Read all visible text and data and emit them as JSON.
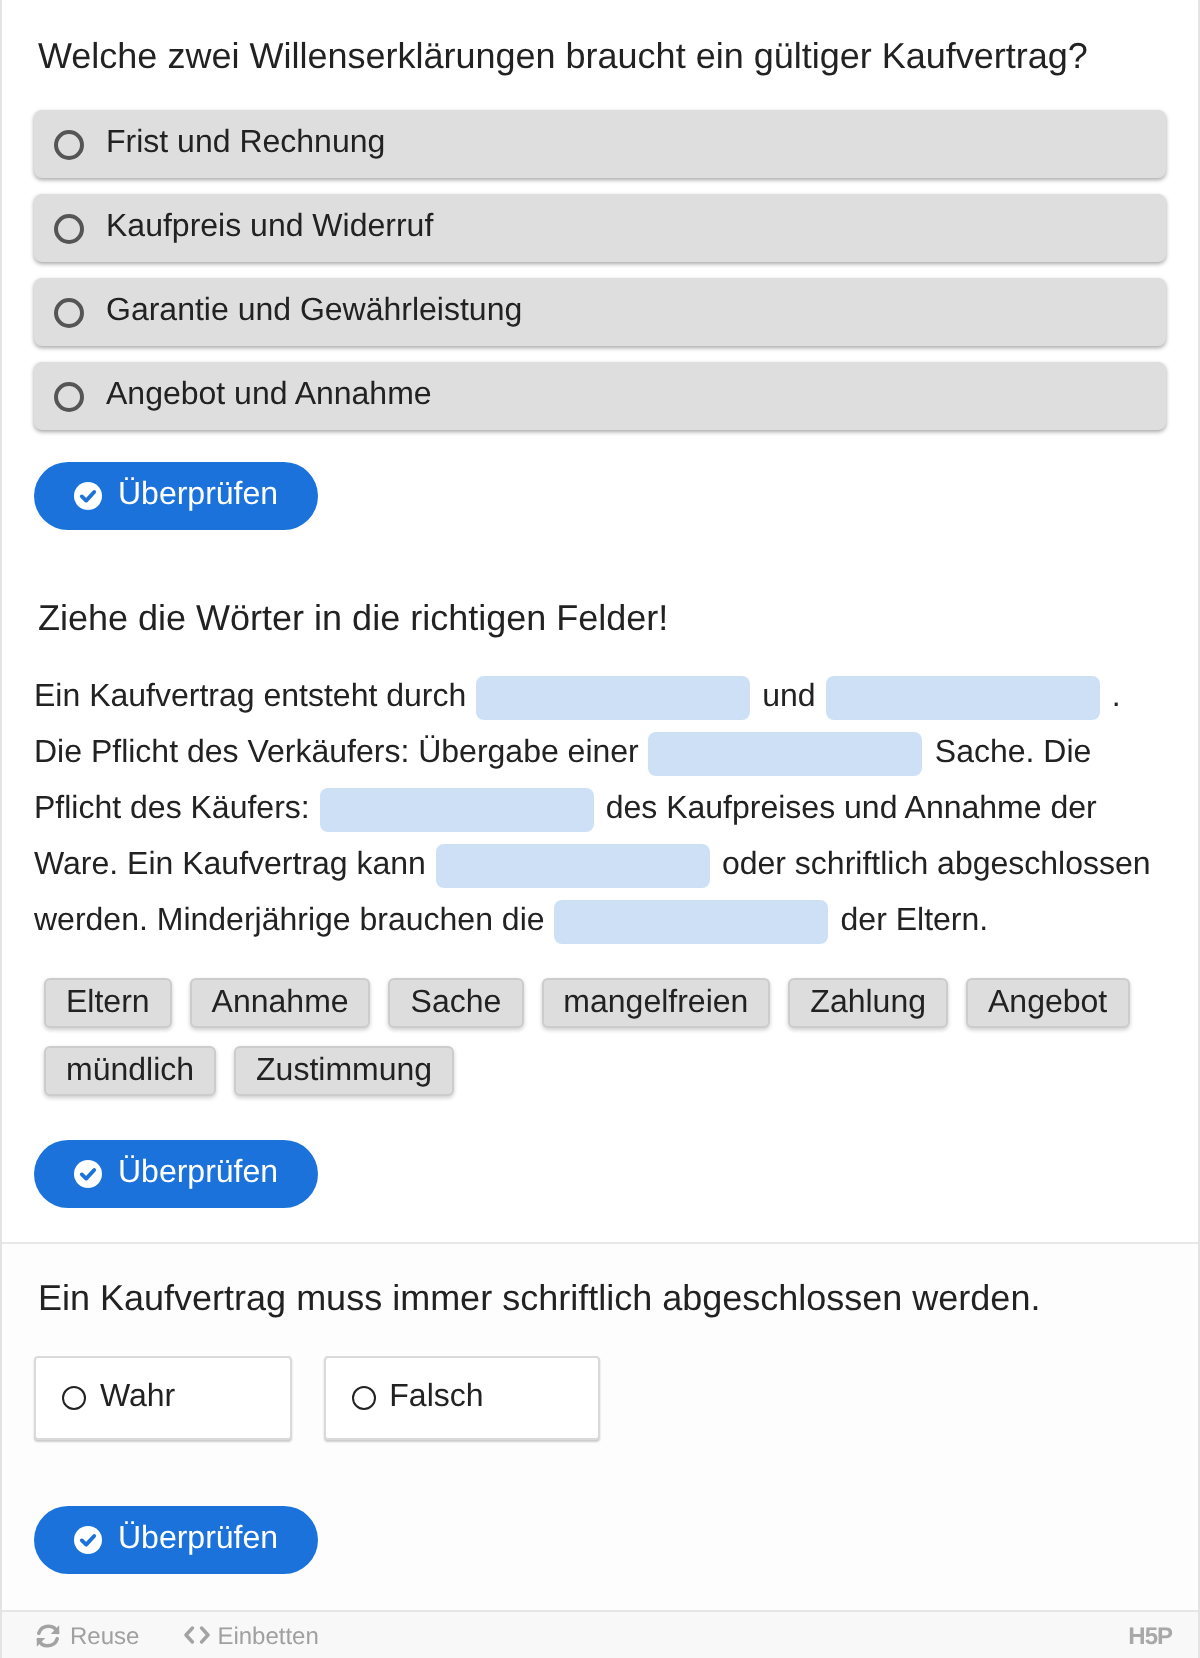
{
  "questions": [
    {
      "kind": "multichoice",
      "question": "Welche zwei Willenserklärungen braucht ein gültiger Kaufvertrag?",
      "options": [
        {
          "label": "Frist und Rechnung",
          "selected": false
        },
        {
          "label": "Kaufpreis und Widerruf",
          "selected": false
        },
        {
          "label": "Garantie und Gewährleistung",
          "selected": false
        },
        {
          "label": "Angebot und Annahme",
          "selected": false
        }
      ],
      "button": "Überprüfen"
    },
    {
      "kind": "drag_text",
      "instruction": "Ziehe die Wörter in die richtigen Felder!",
      "text_lines": [
        [
          {
            "kind": "text",
            "text": "Ein Kaufvertrag entsteht durch"
          },
          {
            "kind": "blank"
          },
          {
            "kind": "text",
            "text": "und"
          },
          {
            "kind": "blank"
          },
          {
            "kind": "text",
            "text": "."
          }
        ],
        [
          {
            "kind": "text",
            "text": "Die Pflicht des Verkäufers: Übergabe einer"
          },
          {
            "kind": "blank"
          },
          {
            "kind": "text",
            "text": "Sache. Die"
          }
        ],
        [
          {
            "kind": "text",
            "text": "Pflicht des Käufers:"
          },
          {
            "kind": "blank"
          },
          {
            "kind": "text",
            "text": "des Kaufpreises und Annahme der"
          }
        ],
        [
          {
            "kind": "text",
            "text": "Ware. Ein Kaufvertrag kann"
          },
          {
            "kind": "blank"
          },
          {
            "kind": "text",
            "text": "oder schriftlich abgeschlossen"
          }
        ],
        [
          {
            "kind": "text",
            "text": "werden. Minderjährige brauchen die"
          },
          {
            "kind": "blank"
          },
          {
            "kind": "text",
            "text": "der Eltern."
          }
        ]
      ],
      "words": [
        "Eltern",
        "Annahme",
        "Sache",
        "mangelfreien",
        "Zahlung",
        "Angebot",
        "mündlich",
        "Zustimmung"
      ],
      "button": "Überprüfen"
    },
    {
      "kind": "true_false",
      "question": "Ein Kaufvertrag muss immer schriftlich abgeschlossen werden.",
      "options": [
        {
          "label": "Wahr",
          "selected": false
        },
        {
          "label": "Falsch",
          "selected": false
        }
      ],
      "button": "Überprüfen"
    }
  ],
  "footer": {
    "actions": [
      {
        "kind": "reuse",
        "label": "Reuse"
      },
      {
        "kind": "embed",
        "label": "Einbetten"
      }
    ],
    "logo": "H5P"
  }
}
